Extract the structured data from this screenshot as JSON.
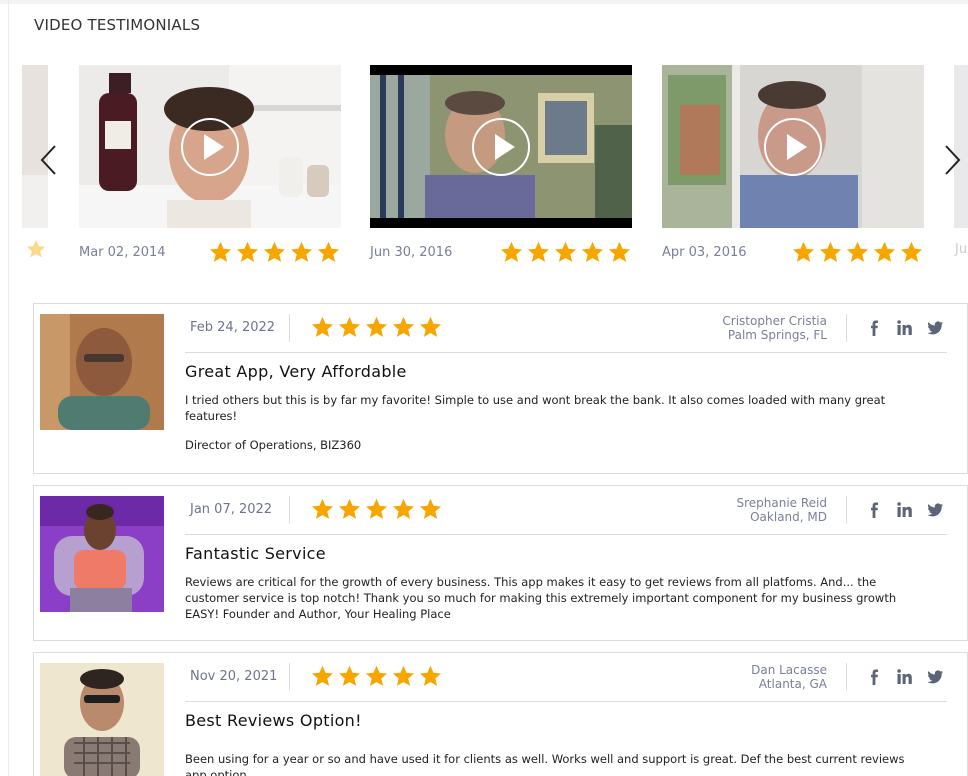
{
  "section": {
    "title": "VIDEO TESTIMONIALS"
  },
  "colors": {
    "star": "#f7a600",
    "muted_text": "#7a7f9a",
    "border": "#dcdcdc",
    "social_icon": "#5c6478"
  },
  "icons": {
    "prev": "chevron-left-icon",
    "next": "chevron-right-icon",
    "play": "play-icon",
    "star": "star-icon",
    "facebook": "facebook-icon",
    "linkedin": "linkedin-icon",
    "twitter": "twitter-icon"
  },
  "carousel": {
    "partial_right_date": "Ju",
    "videos": [
      {
        "date": "Mar 02, 2014",
        "rating": 5
      },
      {
        "date": "Jun 30, 2016",
        "rating": 5
      },
      {
        "date": "Apr 03, 2016",
        "rating": 5
      }
    ]
  },
  "reviews": [
    {
      "date": "Feb 24, 2022",
      "rating": 5,
      "author_name": "Cristopher Cristia",
      "author_location": "Palm Springs, FL",
      "title": "Great App, Very Affordable",
      "body": "I tried others but this is by far my favorite! Simple to use and wont break the bank. It also comes loaded with many great features!",
      "role": "Director of Operations, BIZ360"
    },
    {
      "date": "Jan 07, 2022",
      "rating": 5,
      "author_name": "Srephanie Reid",
      "author_location": "Oakland, MD",
      "title": "Fantastic Service",
      "body": "Reviews are critical for the growth of every business. This app makes it easy to get reviews from all platfoms. And... the customer service is top notch! Thank you so much for making this extremely important component for my business growth EASY! Founder and Author, Your Healing Place",
      "role": ""
    },
    {
      "date": "Nov 20, 2021",
      "rating": 5,
      "author_name": "Dan Lacasse",
      "author_location": "Atlanta, GA",
      "title": "Best Reviews Option!",
      "body": "Been using for a year or so and have used it for clients as well. Works well and support is great. Def the best current reviews app option.",
      "role": ""
    }
  ]
}
